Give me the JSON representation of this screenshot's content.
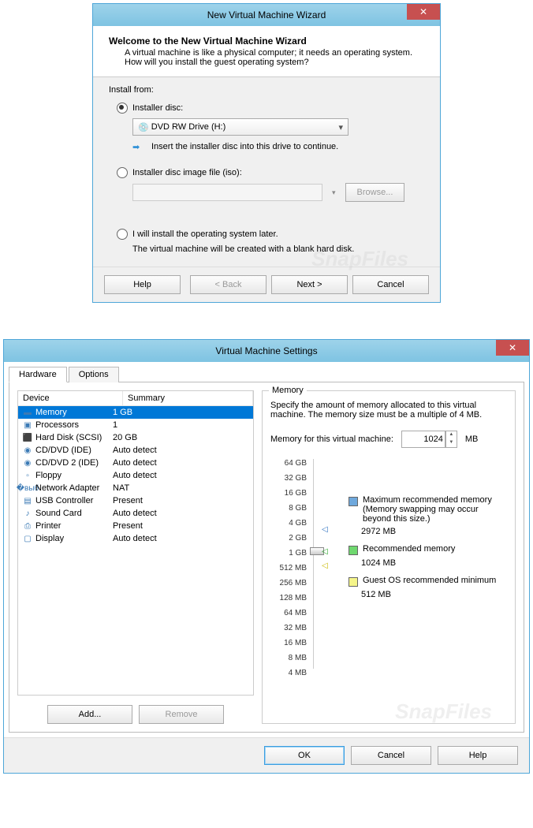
{
  "wizard": {
    "title": "New Virtual Machine Wizard",
    "welcome_title": "Welcome to the New Virtual Machine Wizard",
    "welcome_desc": "A virtual machine is like a physical computer; it needs an operating system. How will you install the guest operating system?",
    "install_from": "Install from:",
    "radio_disc": "Installer disc:",
    "drive": "DVD RW Drive (H:)",
    "hint": "Insert the installer disc into this drive to continue.",
    "radio_iso": "Installer disc image file (iso):",
    "browse": "Browse...",
    "radio_later": "I will install the operating system later.",
    "later_note": "The virtual machine will be created with a blank hard disk.",
    "help": "Help",
    "back": "< Back",
    "next": "Next >",
    "cancel": "Cancel"
  },
  "settings": {
    "title": "Virtual Machine Settings",
    "tabs": {
      "hardware": "Hardware",
      "options": "Options"
    },
    "headers": {
      "device": "Device",
      "summary": "Summary"
    },
    "devices": [
      {
        "icon": "▬",
        "name": "Memory",
        "summary": "1 GB",
        "selected": true
      },
      {
        "icon": "▣",
        "name": "Processors",
        "summary": "1"
      },
      {
        "icon": "⬛",
        "name": "Hard Disk (SCSI)",
        "summary": "20 GB"
      },
      {
        "icon": "◉",
        "name": "CD/DVD (IDE)",
        "summary": "Auto detect"
      },
      {
        "icon": "◉",
        "name": "CD/DVD 2 (IDE)",
        "summary": "Auto detect"
      },
      {
        "icon": "▫",
        "name": "Floppy",
        "summary": "Auto detect"
      },
      {
        "icon": "�выб",
        "name": "Network Adapter",
        "summary": "NAT"
      },
      {
        "icon": "▤",
        "name": "USB Controller",
        "summary": "Present"
      },
      {
        "icon": "♪",
        "name": "Sound Card",
        "summary": "Auto detect"
      },
      {
        "icon": "⎙",
        "name": "Printer",
        "summary": "Present"
      },
      {
        "icon": "▢",
        "name": "Display",
        "summary": "Auto detect"
      }
    ],
    "add": "Add...",
    "remove": "Remove",
    "memory": {
      "group": "Memory",
      "desc": "Specify the amount of memory allocated to this virtual machine. The memory size must be a multiple of 4 MB.",
      "label": "Memory for this virtual machine:",
      "value": "1024",
      "unit": "MB",
      "ticks": [
        "64 GB",
        "32 GB",
        "16 GB",
        "8 GB",
        "4 GB",
        "2 GB",
        "1 GB",
        "512 MB",
        "256 MB",
        "128 MB",
        "64 MB",
        "32 MB",
        "16 MB",
        "8 MB",
        "4 MB"
      ],
      "max_label": "Maximum recommended memory",
      "max_note": "(Memory swapping may occur beyond this size.)",
      "max_val": "2972 MB",
      "rec_label": "Recommended memory",
      "rec_val": "1024 MB",
      "min_label": "Guest OS recommended minimum",
      "min_val": "512 MB"
    },
    "ok": "OK",
    "cancel": "Cancel",
    "help": "Help"
  },
  "watermark": "SnapFiles"
}
